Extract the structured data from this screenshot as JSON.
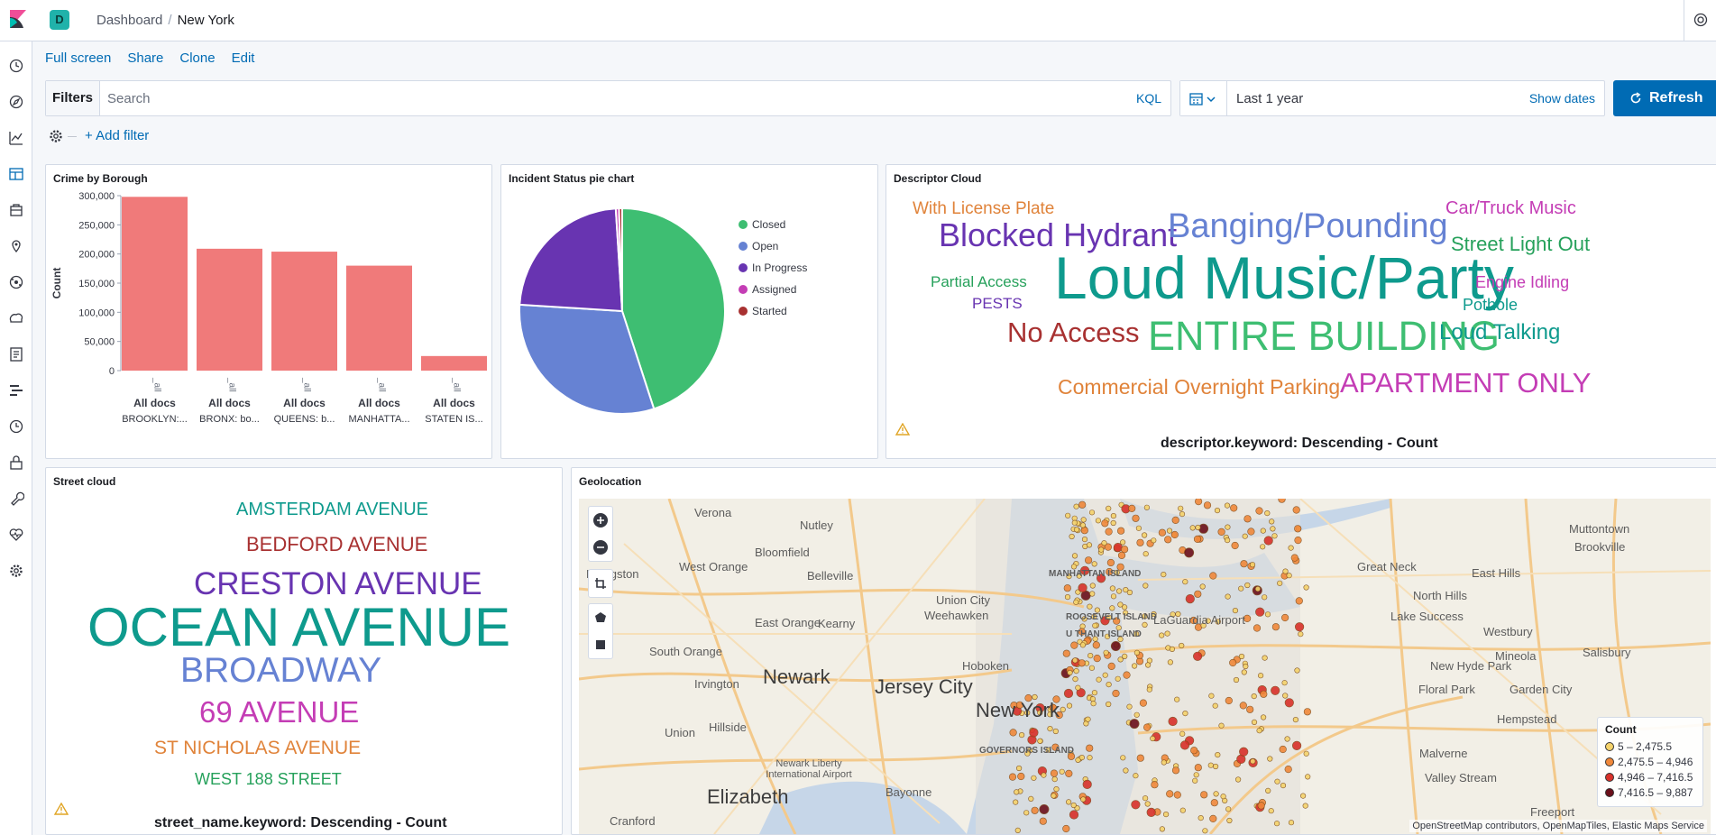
{
  "header": {
    "space_initial": "D",
    "breadcrumbs": [
      "Dashboard",
      "New York"
    ]
  },
  "top_nav": {
    "actions": [
      "Full screen",
      "Share",
      "Clone",
      "Edit"
    ]
  },
  "query_bar": {
    "filters_label": "Filters",
    "search_placeholder": "Search",
    "language": "KQL",
    "time_range": "Last 1 year",
    "show_dates": "Show dates",
    "refresh_label": "Refresh",
    "add_filter": "+ Add filter"
  },
  "panels": {
    "crime_by_borough": {
      "title": "Crime by Borough",
      "chart_data": {
        "type": "bar",
        "categories": [
          "BROOKLYN:...",
          "BRONX: bo...",
          "QUEENS: b...",
          "MANHATTA...",
          "STATEN IS..."
        ],
        "category_group_label": "All docs",
        "rotated_tick_label": "_all",
        "values": [
          298000,
          209000,
          204000,
          180000,
          25000
        ],
        "ylabel": "Count",
        "ylim": [
          0,
          300000
        ],
        "yticks": [
          "300,000",
          "250,000",
          "200,000",
          "150,000",
          "100,000",
          "50,000",
          "0"
        ],
        "color": "#f07a7a"
      }
    },
    "incident_status": {
      "title": "Incident Status pie chart",
      "chart_data": {
        "type": "pie",
        "labels": [
          "Closed",
          "Open",
          "In Progress",
          "Assigned",
          "Started"
        ],
        "values": [
          45,
          31,
          23,
          0.5,
          0.5
        ],
        "colors": [
          "#3ebe72",
          "#6682d3",
          "#6834b1",
          "#c43db5",
          "#a83131"
        ]
      }
    },
    "descriptor_cloud": {
      "title": "Descriptor Cloud",
      "caption": "descriptor.keyword: Descending - Count",
      "words": [
        {
          "text": "With License Plate",
          "color": "#e0833a"
        },
        {
          "text": "Car/Truck Music",
          "color": "#c43db5"
        },
        {
          "text": "Blocked Hydrant",
          "color": "#6834b1"
        },
        {
          "text": "Banging/Pounding",
          "color": "#6682d3"
        },
        {
          "text": "Street Light Out",
          "color": "#26a15b"
        },
        {
          "text": "Partial Access",
          "color": "#26a15b"
        },
        {
          "text": "Loud Music/Party",
          "color": "#0e9a8d"
        },
        {
          "text": "Engine Idling",
          "color": "#c43db5"
        },
        {
          "text": "PESTS",
          "color": "#6834b1"
        },
        {
          "text": "Pothole",
          "color": "#0e9a8d"
        },
        {
          "text": "No Access",
          "color": "#a83131"
        },
        {
          "text": "ENTIRE BUILDING",
          "color": "#3ebe72"
        },
        {
          "text": "Loud Talking",
          "color": "#0e9a8d"
        },
        {
          "text": "Commercial Overnight Parking",
          "color": "#e0833a"
        },
        {
          "text": "APARTMENT ONLY",
          "color": "#c43db5"
        }
      ]
    },
    "street_cloud": {
      "title": "Street cloud",
      "caption": "street_name.keyword: Descending - Count",
      "words": [
        {
          "text": "AMSTERDAM AVENUE",
          "color": "#0e9a8d"
        },
        {
          "text": "BEDFORD AVENUE",
          "color": "#a83131"
        },
        {
          "text": "CRESTON AVENUE",
          "color": "#6834b1"
        },
        {
          "text": "OCEAN AVENUE",
          "color": "#0e9a8d"
        },
        {
          "text": "BROADWAY",
          "color": "#6682d3"
        },
        {
          "text": "69 AVENUE",
          "color": "#c43db5"
        },
        {
          "text": "ST NICHOLAS AVENUE",
          "color": "#e0833a"
        },
        {
          "text": "WEST 188 STREET",
          "color": "#26a15b"
        }
      ]
    },
    "geolocation": {
      "title": "Geolocation",
      "places": [
        "Verona",
        "Nutley",
        "Bloomfield",
        "West Orange",
        "Belleville",
        "Livingston",
        "Union City",
        "Weehawken",
        "East Orange",
        "Kearny",
        "South Orange",
        "Newark",
        "Hoboken",
        "Jersey City",
        "Irvington",
        "New York",
        "Hillside",
        "Union",
        "Newark Liberty International Airport",
        "Elizabeth",
        "Bayonne",
        "Cranford",
        "Great Neck",
        "East Hills",
        "North Hills",
        "Lake Success",
        "Westbury",
        "Mineola",
        "New Hyde Park",
        "Garden City",
        "Floral Park",
        "Hempstead",
        "Malverne",
        "Valley Stream",
        "Freeport",
        "Muttontown",
        "Brookville",
        "Salisbury",
        "LaGuardia Airport",
        "MANHATTAN ISLAND",
        "ROOSEVELT ISLAND",
        "U THANT ISLAND",
        "GOVERNORS ISLAND"
      ],
      "legend": {
        "title": "Count",
        "items": [
          {
            "label": "5 – 2,475.5",
            "color": "#f5d36b"
          },
          {
            "label": "2,475.5 – 4,946",
            "color": "#f0883a"
          },
          {
            "label": "4,946 – 7,416.5",
            "color": "#d8312a"
          },
          {
            "label": "7,416.5 – 9,887",
            "color": "#6b0f1a"
          }
        ]
      },
      "attribution": "OpenStreetMap contributors, OpenMapTiles, Elastic Maps Service"
    }
  }
}
